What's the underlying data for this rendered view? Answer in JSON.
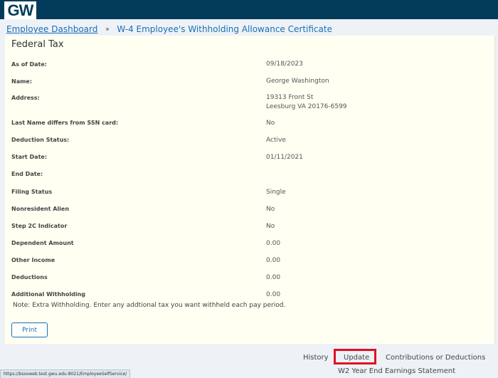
{
  "header": {
    "logo_text": "GW",
    "background": "#033c5a"
  },
  "breadcrumb": {
    "home": "Employee Dashboard",
    "current": "W-4 Employee's Withholding Allowance Certificate"
  },
  "section": {
    "title": "Federal Tax"
  },
  "fields": [
    {
      "label": "As of Date:",
      "value": "09/18/2023"
    },
    {
      "label": "Name:",
      "value": "George Washington"
    },
    {
      "label": "Address:",
      "value": "19313 Front St",
      "value2": "Leesburg VA 20176-6599"
    },
    {
      "label": "Last Name differs from SSN card:",
      "value": "No"
    },
    {
      "label": "Deduction Status:",
      "value": "Active"
    },
    {
      "label": "Start Date:",
      "value": "01/11/2021"
    },
    {
      "label": "End Date:",
      "value": ""
    },
    {
      "label": "Filing Status",
      "value": "Single"
    },
    {
      "label": "Nonresident Alien",
      "value": "No"
    },
    {
      "label": "Step 2C Indicator",
      "value": "No"
    },
    {
      "label": "Dependent Amount",
      "value": "0.00"
    },
    {
      "label": "Other Income",
      "value": "0.00"
    },
    {
      "label": "Deductions",
      "value": "0.00"
    },
    {
      "label": "Additional Withholding",
      "value": "0.00"
    }
  ],
  "note": "Note: Extra Withholding. Enter any addtional tax you want withheld each pay period.",
  "buttons": {
    "print": "Print"
  },
  "footer": {
    "history": "History",
    "update": "Update",
    "contributions": "Contributions or Deductions",
    "w2": "W2 Year End Earnings Statement"
  },
  "status_bar": {
    "url": "https://bssoweb.test.gwu.edu:8021/EmployeeSelfService/"
  },
  "colors": {
    "link": "#1a6fb5",
    "highlight": "#e01020",
    "panel": "#fffff2"
  }
}
